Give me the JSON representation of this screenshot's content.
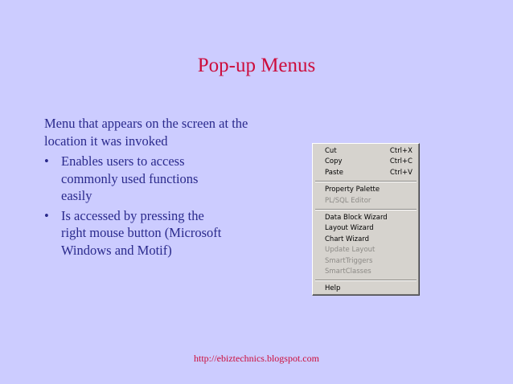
{
  "slide": {
    "title": "Pop-up Menus",
    "intro": "Menu that appears on the screen at the location it was invoked",
    "bullet_marker": "•",
    "bullets": [
      "Enables users to access commonly used functions easily",
      "Is accessed by pressing the right mouse button (Microsoft Windows and Motif)"
    ],
    "footer_url": "http://ebiztechnics.blogspot.com"
  },
  "menu": {
    "group1": [
      {
        "label": "Cut",
        "shortcut": "Ctrl+X"
      },
      {
        "label": "Copy",
        "shortcut": "Ctrl+C"
      },
      {
        "label": "Paste",
        "shortcut": "Ctrl+V"
      }
    ],
    "group2": [
      {
        "label": "Property Palette",
        "disabled": false
      },
      {
        "label": "PL/SQL Editor",
        "disabled": true
      }
    ],
    "group3": [
      {
        "label": "Data Block Wizard",
        "disabled": false
      },
      {
        "label": "Layout Wizard",
        "disabled": false
      },
      {
        "label": "Chart Wizard",
        "disabled": false
      },
      {
        "label": "Update Layout",
        "disabled": true
      },
      {
        "label": "SmartTriggers",
        "disabled": true
      },
      {
        "label": "SmartClasses",
        "disabled": true
      }
    ],
    "group4": [
      {
        "label": "Help",
        "disabled": false
      }
    ]
  },
  "colors": {
    "background": "#ccccff",
    "title": "#cc0d3c",
    "body_text": "#2a2a8c",
    "menu_bg": "#d6d3ce",
    "disabled_text": "#8c8a86"
  }
}
